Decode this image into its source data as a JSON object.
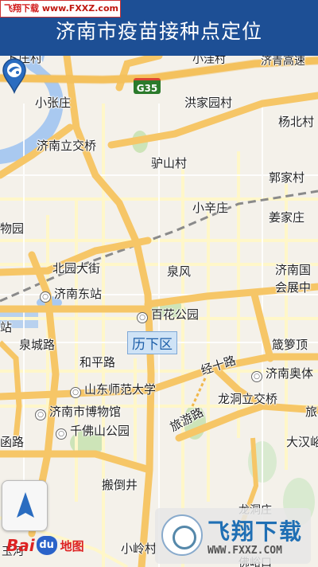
{
  "header": {
    "title": "济南市疫苗接种点定位"
  },
  "watermark_top": {
    "site": "飞翔下载",
    "url": "www.FXXZ.com"
  },
  "map": {
    "highway_shield": "G35",
    "district_label": "历下区",
    "labels": {
      "l1": "ト庄村",
      "l2": "小洼村",
      "l3": "济青高速",
      "l4": "小张庄",
      "l5": "洪家园村",
      "l6": "杨北村",
      "l7": "济南立交桥",
      "l8": "驴山村",
      "l9": "郭家村",
      "l10": "小辛庄",
      "l11": "姜家庄",
      "l12": "物园",
      "l13": "北园大街",
      "l14": "泉风",
      "l15": "济南国",
      "l16": "会展中",
      "l17": "站",
      "l18": "泉城路",
      "l19": "箴箩顶",
      "l20": "和平路",
      "l21": "经十路",
      "l22": "龙洞立交桥",
      "l23": "旅",
      "l24": "旅游路",
      "l25": "函路",
      "l26": "大汉峪",
      "l27": "搬倒井",
      "l28": "龙洞庄",
      "l29": "小岭村",
      "l30": "佛峪口",
      "l31": "玉河"
    },
    "pois": {
      "p1": "济南东站",
      "p2": "百花公园",
      "p3": "山东师范大学",
      "p4": "济南市博物馆",
      "p5": "千佛山公园",
      "p6": "济南奥体"
    }
  },
  "baidu": {
    "bai": "Bai",
    "du": "du",
    "map_word": "地图"
  },
  "watermark_bottom": {
    "brand": "飞翔下载",
    "url": "WWW.FXXZ.COM"
  },
  "colors": {
    "header": "#1d4f95",
    "road_major": "#f6c667",
    "road_minor": "#fff7c9",
    "water": "#a9c9f0",
    "park": "#cde4b8"
  }
}
